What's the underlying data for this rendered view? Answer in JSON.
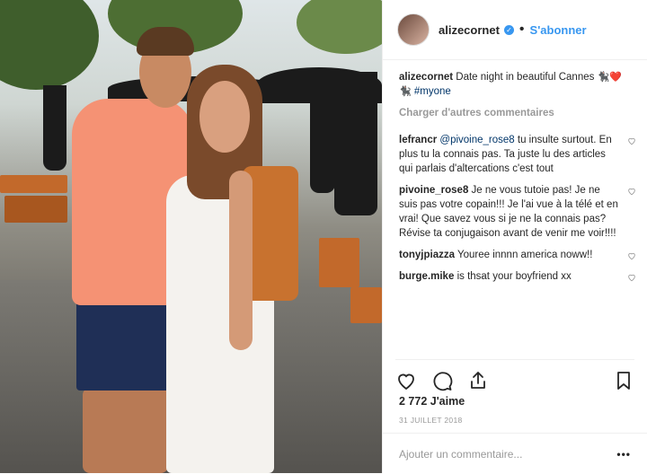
{
  "header": {
    "username": "alizecornet",
    "separator": "•",
    "follow_label": "S'abonner",
    "verified_icon": "verified-badge-icon"
  },
  "caption": {
    "username": "alizecornet",
    "text": "Date night in beautiful Cannes",
    "emojis": "🐈‍⬛❤️ 🐈‍⬛",
    "hashtag": "#myone"
  },
  "load_more": "Charger d'autres commentaires",
  "comments": [
    {
      "username": "lefrancr",
      "mention": "@pivoine_rose8",
      "text": "tu insulte surtout. En plus tu la connais pas. Ta juste lu des articles qui parlais d'altercations c'est tout"
    },
    {
      "username": "pivoine_rose8",
      "mention": "",
      "text": "Je ne vous tutoie pas! Je ne suis pas votre copain!!! Je l'ai vue à la télé et en vrai! Que savez vous si je ne la connais pas? Révise ta conjugaison avant de venir me voir!!!!"
    },
    {
      "username": "tonyjpiazza",
      "mention": "",
      "text": "Youree innnn america noww!!"
    },
    {
      "username": "burge.mike",
      "mention": "",
      "text": "is thsat your boyfriend xx"
    }
  ],
  "likes": "2 772 J'aime",
  "date": "31 JUILLET 2018",
  "add_comment_placeholder": "Ajouter un commentaire...",
  "more_label": "•••",
  "colors": {
    "accent": "#3897f0",
    "text": "#262626",
    "muted": "#999999"
  }
}
